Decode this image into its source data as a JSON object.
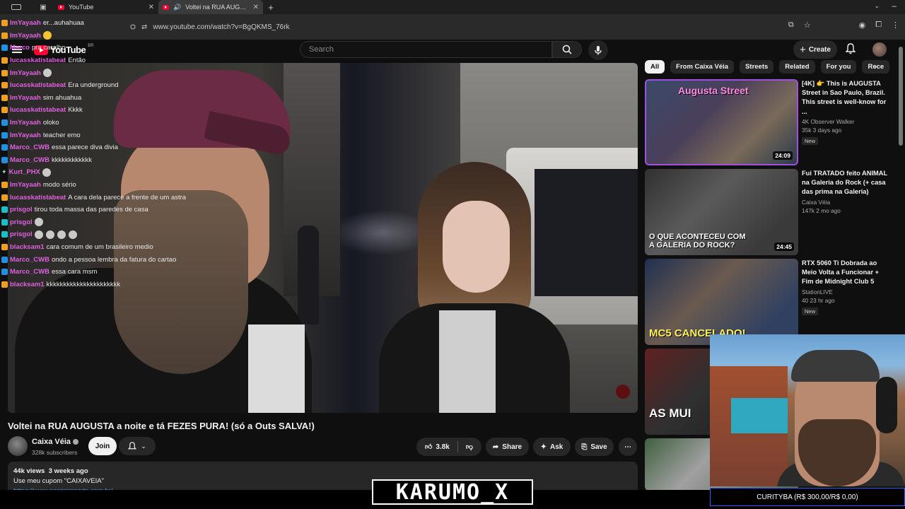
{
  "browser": {
    "tabs": [
      {
        "title": "YouTube",
        "active": false
      },
      {
        "title": "Voltei na RUA AUGUSTA a noite e tá FEZES PURA!",
        "active": true
      }
    ],
    "url": "www.youtube.com/watch?v=BgQKMS_76rk"
  },
  "yt": {
    "logo": "YouTube",
    "country": "BR",
    "search_placeholder": "Search",
    "create_label": "Create"
  },
  "chat": [
    {
      "user": "ImYayaah",
      "msg": "er...auhahuaa",
      "badge": "orange"
    },
    {
      "user": "ImYayaah",
      "msg": "",
      "badge": "orange",
      "emote": "y"
    },
    {
      "user": "Marco",
      "msg": "pra caralho",
      "badge": "blue"
    },
    {
      "user": "lucasskatistabeat",
      "msg": "Então",
      "badge": "orange"
    },
    {
      "user": "ImYayaah",
      "msg": "",
      "badge": "orange",
      "emote": "g"
    },
    {
      "user": "lucasskatistabeat",
      "msg": "Era underground",
      "badge": "orange"
    },
    {
      "user": "ImYayaah",
      "msg": "sim ahuahua",
      "badge": "orange"
    },
    {
      "user": "lucasskatistabeat",
      "msg": "Kkkk",
      "badge": "orange"
    },
    {
      "user": "ImYayaah",
      "msg": "oloko",
      "badge": "blue"
    },
    {
      "user": "ImYayaah",
      "msg": "teacher emo",
      "badge": "blue"
    },
    {
      "user": "Marco_CWB",
      "msg": "essa parece diva divia",
      "badge": "blue"
    },
    {
      "user": "Marco_CWB",
      "msg": "kkkkkkkkkkkk",
      "badge": "blue"
    },
    {
      "user": "Kurt_PHX",
      "msg": "",
      "badge": "star",
      "emote": "g"
    },
    {
      "user": "ImYayaah",
      "msg": "modo sério",
      "badge": "orange"
    },
    {
      "user": "lucasskatistabeat",
      "msg": "A cara dela parece a frente de um astra",
      "badge": "orange"
    },
    {
      "user": "prisgol",
      "msg": "tirou toda massa das paredes de casa",
      "badge": "cyan"
    },
    {
      "user": "prisgol",
      "msg": "",
      "badge": "cyan",
      "emote": "g"
    },
    {
      "user": "prisgol",
      "msg": "",
      "badge": "cyan",
      "emote": "gggg"
    },
    {
      "user": "blacksam1",
      "msg": "cara comum de um brasileiro medio",
      "badge": "orange"
    },
    {
      "user": "Marco_CWB",
      "msg": "ondo a pessoa lembra da fatura do cartao",
      "badge": "blue"
    },
    {
      "user": "Marco_CWB",
      "msg": "essa cara msm",
      "badge": "blue"
    },
    {
      "user": "blacksam1",
      "msg": "kkkkkkkkkkkkkkkkkkkkkk",
      "badge": "orange"
    }
  ],
  "video": {
    "title": "Voltei na RUA AUGUSTA a noite e tá FEZES PURA! (só a Outs SALVA!)",
    "channel": "Caixa Véia",
    "subscribers": "328k subscribers",
    "join_label": "Join",
    "likes": "3.8k",
    "share_label": "Share",
    "ask_label": "Ask",
    "save_label": "Save",
    "views": "44k views",
    "age": "3 weeks ago",
    "desc_line1": "Use meu cupom \"CAIXAVEIA\"",
    "desc_link": "https://www.perrisimports.com.br/"
  },
  "chips": [
    "All",
    "From Caixa Véia",
    "Streets",
    "Related",
    "For you",
    "Rece"
  ],
  "recommendations": [
    {
      "title": "[4K] 👉 This is AUGUSTA Street in Sao Paulo, Brazil. This street is well-know for ...",
      "channel": "4K Observer Walker",
      "meta": "35k  3 days ago",
      "badge": "New",
      "duration": "24:09",
      "thumb_text": "Augusta Street"
    },
    {
      "title": "Fui TRATADO feito ANIMAL na Galeria do Rock (+ casa das prima na Galeria)",
      "channel": "Caixa Véia",
      "meta": "147k  2 mo ago",
      "badge": "",
      "duration": "24:45",
      "thumb_text": "O QUE ACONTECEU COM A GALERIA DO ROCK?"
    },
    {
      "title": "RTX 5060 Ti Dobrada ao Meio Volta a Funcionar + Fim de Midnight Club 5",
      "channel": "StationLIVE",
      "meta": "40  23 hr ago",
      "badge": "New",
      "duration": "",
      "thumb_text": "MC5 CANCELADO!"
    },
    {
      "title": "",
      "channel": "",
      "meta": "",
      "badge": "",
      "duration": "",
      "thumb_text": "AS MUI"
    },
    {
      "title": "",
      "channel": "",
      "meta": "",
      "badge": "",
      "duration": "",
      "thumb_text": ""
    }
  ],
  "stream": {
    "streamer": "KARUMO_X",
    "city_label": "CURITYBA (R$ 300,00/R$ 0,00)"
  }
}
